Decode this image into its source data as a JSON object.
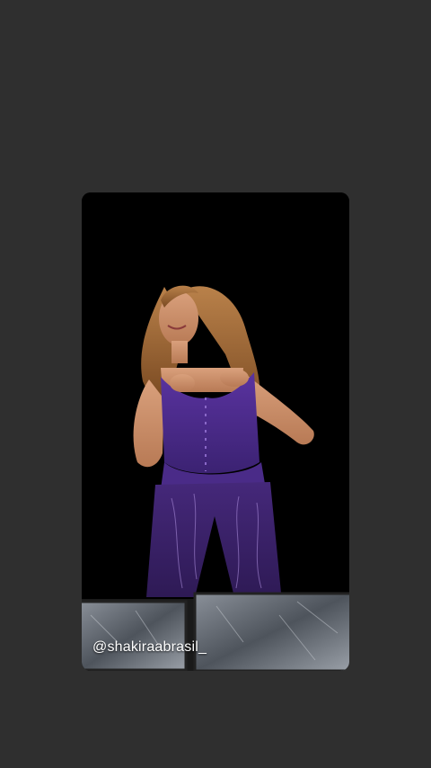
{
  "story": {
    "mention": "@shakiraabrasil_",
    "background_color": "#2f2f2f",
    "outfit_color": "#4b2a86"
  }
}
